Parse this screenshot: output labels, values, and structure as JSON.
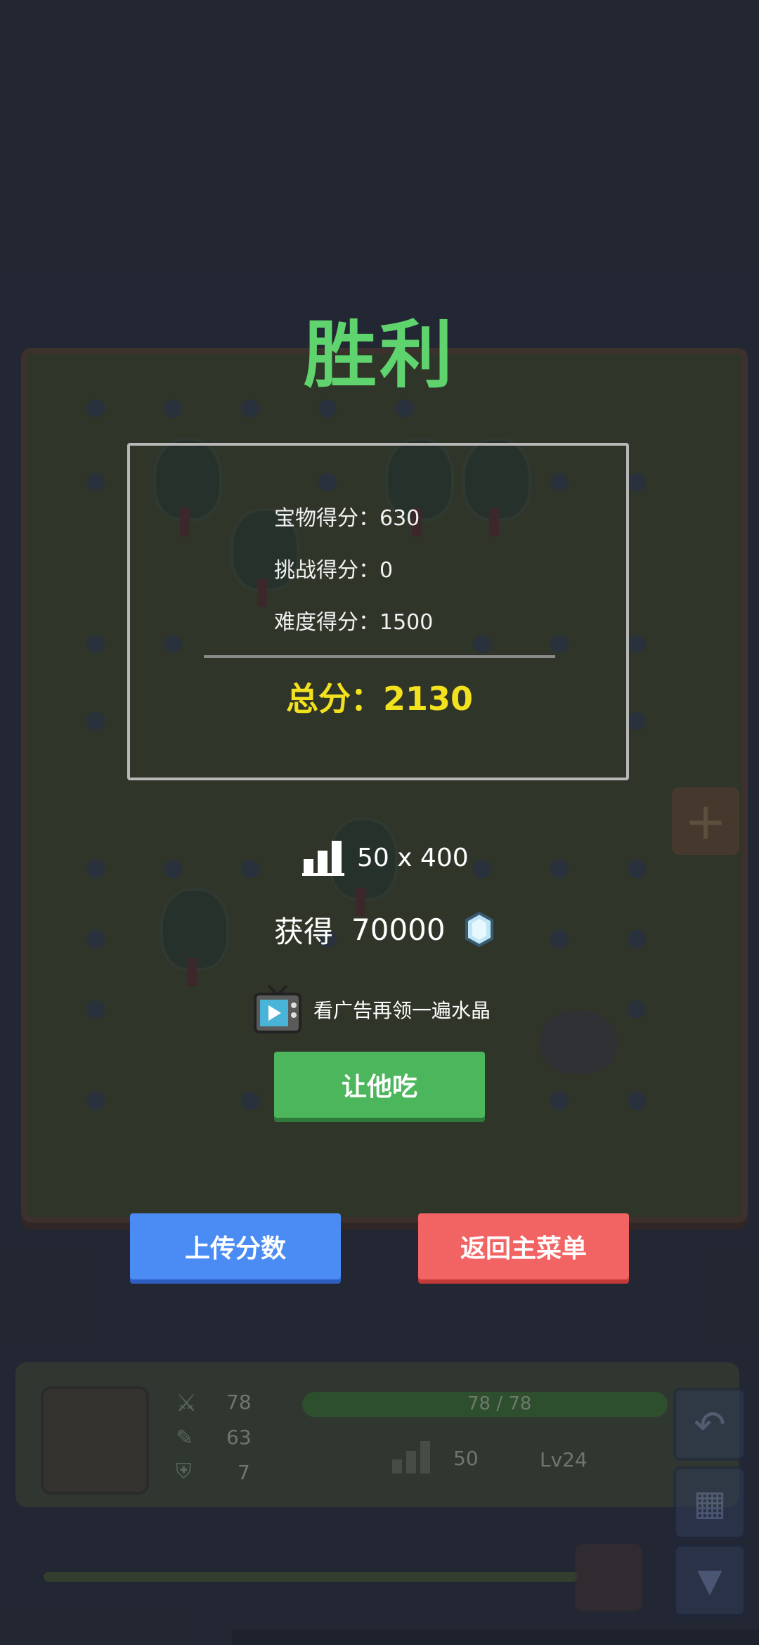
{
  "result": {
    "title": "胜利",
    "scores": [
      {
        "label": "宝物得分：630"
      },
      {
        "label": "挑战得分：0"
      },
      {
        "label": "难度得分：1500"
      }
    ],
    "total_label": "总分：",
    "total_value": "2130",
    "rank_text": "50 x 400",
    "reward_label": "获得",
    "reward_value": "70000",
    "ad_text": "看广告再领一遍水晶",
    "eat_button": "让他吃",
    "upload_button": "上传分数",
    "menu_button": "返回主菜单"
  },
  "status": {
    "attack": "78",
    "magic": "63",
    "defense": "7",
    "hp_text": "78 / 78",
    "floor": "50",
    "level": "Lv24"
  },
  "colors": {
    "title": "#5fd36e",
    "total": "#f2e21e",
    "eat_button": "#4cb65c",
    "upload_button": "#4a8cf4",
    "menu_button": "#f26464",
    "background": "#272c38"
  },
  "icons": [
    "bar-chart-icon",
    "crystal-icon",
    "tv-icon",
    "sword-icon",
    "wand-icon",
    "shield-icon",
    "back-arrow-icon",
    "grid-icon",
    "down-arrow-icon",
    "plus-icon"
  ]
}
